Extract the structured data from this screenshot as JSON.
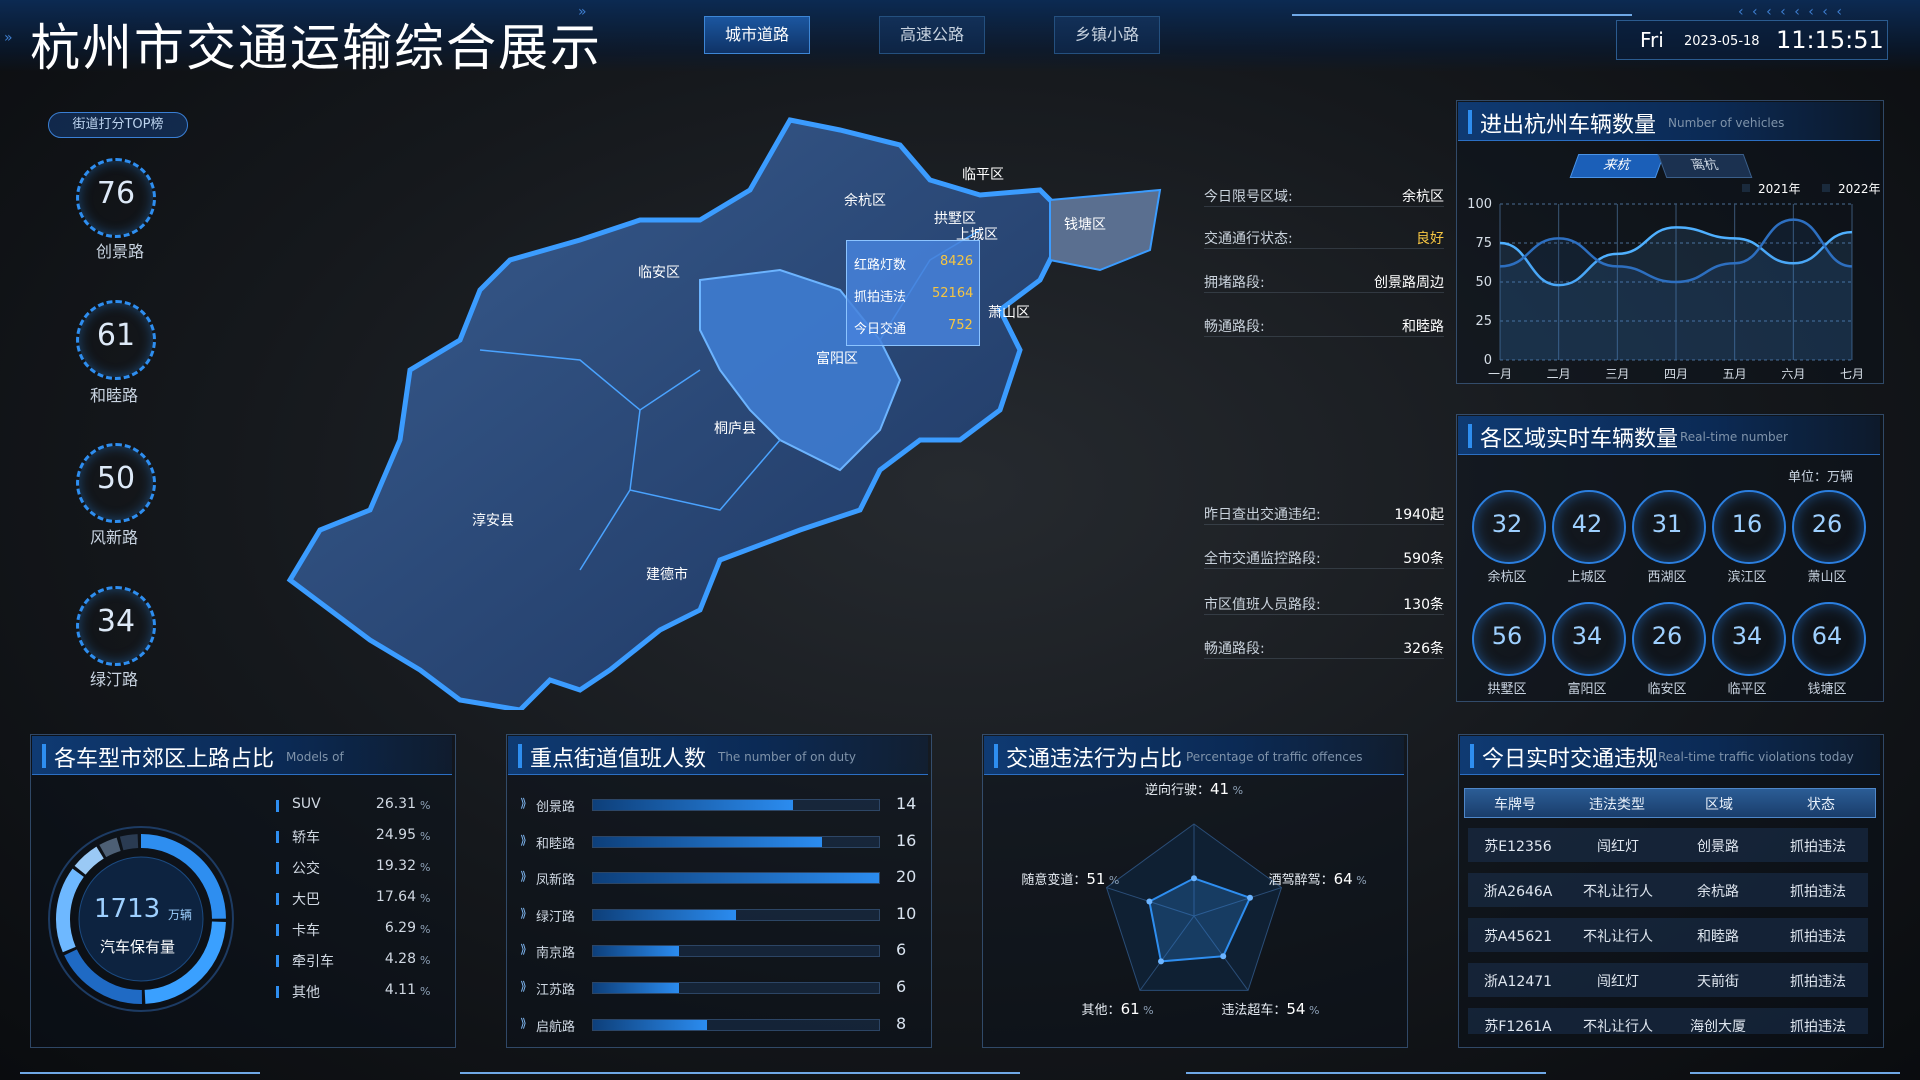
{
  "header": {
    "title": "杭州市交通运输综合展示",
    "tabs": [
      {
        "label": "城市道路",
        "active": true
      },
      {
        "label": "高速公路",
        "active": false
      },
      {
        "label": "乡镇小路",
        "active": false
      }
    ],
    "day": "Fri",
    "date": "2023-05-18",
    "time": "11:15:51"
  },
  "street_rank": {
    "tag": "街道打分TOP榜",
    "items": [
      {
        "score": "76",
        "name": "创景路"
      },
      {
        "score": "61",
        "name": "和睦路"
      },
      {
        "score": "50",
        "name": "风新路"
      },
      {
        "score": "34",
        "name": "绿汀路"
      }
    ]
  },
  "map": {
    "districts": [
      "临平区",
      "余杭区",
      "拱墅区",
      "上城区",
      "钱塘区",
      "临安区",
      "萧山区",
      "富阳区",
      "桐庐县",
      "淳安县",
      "建德市"
    ],
    "popup": [
      {
        "label": "红路灯数",
        "value": "8426"
      },
      {
        "label": "抓拍违法",
        "value": "52164"
      },
      {
        "label": "今日交通",
        "value": "752"
      }
    ]
  },
  "status_top": [
    {
      "label": "今日限号区域:",
      "value": "余杭区"
    },
    {
      "label": "交通通行状态:",
      "value": "良好",
      "highlight": true
    },
    {
      "label": "拥堵路段:",
      "value": "创景路周边"
    },
    {
      "label": "畅通路段:",
      "value": "和睦路"
    }
  ],
  "status_bottom": [
    {
      "label": "昨日查出交通违纪:",
      "value": "1940起"
    },
    {
      "label": "全市交通监控路段:",
      "value": "590条"
    },
    {
      "label": "市区值班人员路段:",
      "value": "130条"
    },
    {
      "label": "畅通路段:",
      "value": "326条"
    }
  ],
  "vehicles_panel": {
    "title": "进出杭州车辆数量",
    "subtitle": "Number of vehicles",
    "toggle": [
      "来杭",
      "离杭"
    ],
    "legend": [
      "2021年",
      "2022年"
    ]
  },
  "chart_data": {
    "type": "line",
    "categories": [
      "一月",
      "二月",
      "三月",
      "四月",
      "五月",
      "六月",
      "七月"
    ],
    "series": [
      {
        "name": "2021年",
        "values": [
          75,
          48,
          68,
          85,
          78,
          62,
          82
        ]
      },
      {
        "name": "2022年",
        "values": [
          60,
          78,
          60,
          50,
          62,
          90,
          60
        ]
      }
    ],
    "ylim": [
      0,
      100
    ],
    "yticks": [
      0,
      25,
      50,
      75,
      100
    ],
    "legend_position": "top-right"
  },
  "region_panel": {
    "title": "各区域实时车辆数量",
    "subtitle": "Real-time number",
    "unit": "单位：万辆",
    "items": [
      {
        "value": "32",
        "name": "余杭区"
      },
      {
        "value": "42",
        "name": "上城区"
      },
      {
        "value": "31",
        "name": "西湖区"
      },
      {
        "value": "16",
        "name": "滨江区"
      },
      {
        "value": "26",
        "name": "萧山区"
      },
      {
        "value": "56",
        "name": "拱墅区"
      },
      {
        "value": "34",
        "name": "富阳区"
      },
      {
        "value": "26",
        "name": "临安区"
      },
      {
        "value": "34",
        "name": "临平区"
      },
      {
        "value": "64",
        "name": "钱塘区"
      }
    ]
  },
  "vehicle_types": {
    "title": "各车型市郊区上路占比",
    "subtitle": "Models of",
    "center_value": "1713",
    "center_unit": "万辆",
    "center_label": "汽车保有量",
    "items": [
      {
        "name": "SUV",
        "value": "26.31",
        "unit": "%"
      },
      {
        "name": "轿车",
        "value": "24.95",
        "unit": "%"
      },
      {
        "name": "公交",
        "value": "19.32",
        "unit": "%"
      },
      {
        "name": "大巴",
        "value": "17.64",
        "unit": "%"
      },
      {
        "name": "卡车",
        "value": "6.29",
        "unit": "%"
      },
      {
        "name": "牵引车",
        "value": "4.28",
        "unit": "%"
      },
      {
        "name": "其他",
        "value": "4.11",
        "unit": "%"
      }
    ]
  },
  "duty": {
    "title": "重点街道值班人数",
    "subtitle": "The number of on duty",
    "max": 20,
    "items": [
      {
        "name": "创景路",
        "value": 14
      },
      {
        "name": "和睦路",
        "value": 16
      },
      {
        "name": "凤新路",
        "value": 20
      },
      {
        "name": "绿汀路",
        "value": 10
      },
      {
        "name": "南京路",
        "value": 6
      },
      {
        "name": "江苏路",
        "value": 6
      },
      {
        "name": "启航路",
        "value": 8
      }
    ]
  },
  "offences": {
    "title": "交通违法行为占比",
    "subtitle": "Percentage of traffic offences",
    "max": 100,
    "items": [
      {
        "name": "逆向行驶",
        "value": 41,
        "unit": "%"
      },
      {
        "name": "酒驾醉驾",
        "value": 64,
        "unit": "%"
      },
      {
        "name": "违法超车",
        "value": 54,
        "unit": "%"
      },
      {
        "name": "其他",
        "value": 61,
        "unit": "%"
      },
      {
        "name": "随意变道",
        "value": 51,
        "unit": "%"
      }
    ]
  },
  "violations": {
    "title": "今日实时交通违规",
    "subtitle": "Real-time traffic violations today",
    "columns": [
      "车牌号",
      "违法类型",
      "区域",
      "状态"
    ],
    "rows": [
      [
        "苏E12356",
        "闯红灯",
        "创景路",
        "抓拍违法"
      ],
      [
        "浙A2646A",
        "不礼让行人",
        "余杭路",
        "抓拍违法"
      ],
      [
        "苏A45621",
        "不礼让行人",
        "和睦路",
        "抓拍违法"
      ],
      [
        "浙A12471",
        "闯红灯",
        "天前街",
        "抓拍违法"
      ],
      [
        "苏F1261A",
        "不礼让行人",
        "海创大厦",
        "抓拍违法"
      ]
    ]
  },
  "colors": {
    "accent": "#2e8ef0",
    "highlight": "#f5c542",
    "series_a": "#4fb0ff",
    "series_b": "#2d6fc0"
  }
}
